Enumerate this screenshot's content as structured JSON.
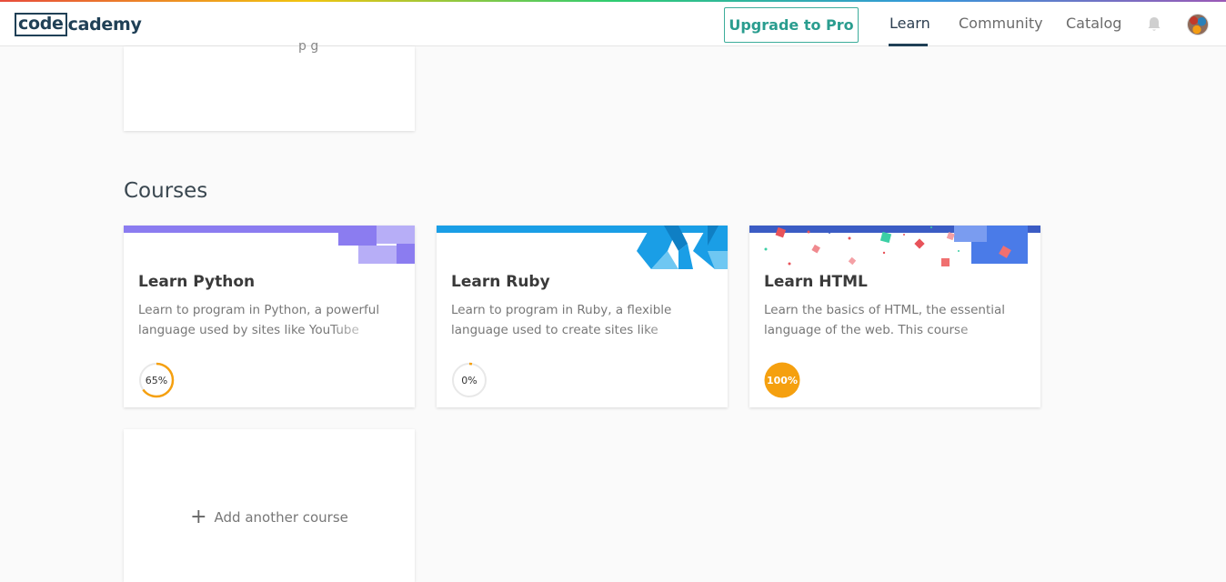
{
  "header": {
    "logo_part1": "code",
    "logo_part2": "cademy",
    "upgrade_label": "Upgrade to Pro",
    "nav": {
      "learn": "Learn",
      "community": "Community",
      "catalog": "Catalog"
    },
    "active_nav": "Learn"
  },
  "partial_card": {
    "fragment": "p     g"
  },
  "section": {
    "title": "Courses"
  },
  "courses": [
    {
      "title": "Learn Python",
      "description": "Learn to program in Python, a powerful language used by sites like YouTube and",
      "progress": "65%",
      "progress_value": 65,
      "accent": "#8b7cf0"
    },
    {
      "title": "Learn Ruby",
      "description": "Learn to program in Ruby, a flexible language used to create sites like",
      "progress": "0%",
      "progress_value": 0,
      "accent": "#1a9ee6"
    },
    {
      "title": "Learn HTML",
      "description": "Learn the basics of HTML, the essential language of the web. This course covers",
      "progress": "100%",
      "progress_value": 100,
      "accent": "#3b5cc4"
    }
  ],
  "add_course": {
    "label": "Add another course"
  },
  "colors": {
    "brand": "#204056",
    "pro_green": "#3dad9b",
    "progress_orange": "#f5a00f"
  },
  "icons": {
    "notification": "bell-icon",
    "add": "plus-icon"
  }
}
